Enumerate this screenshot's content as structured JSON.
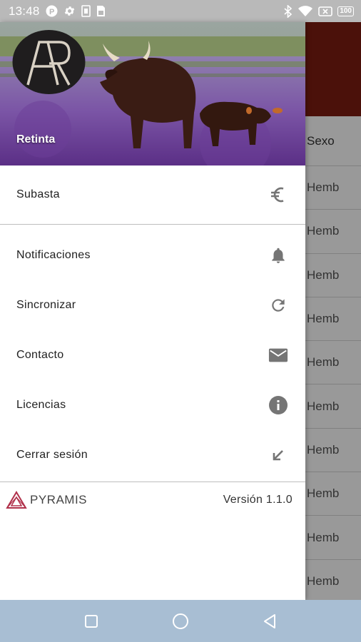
{
  "status_bar": {
    "time": "13:48",
    "left_icons": [
      "p-icon",
      "gear-icon",
      "sd-card-icon",
      "sim-icon"
    ],
    "right_icons": [
      "bluetooth-icon",
      "wifi-icon",
      "close-box-icon"
    ],
    "battery": "100"
  },
  "drawer": {
    "header_title": "Retinta",
    "items": [
      {
        "label": "Subasta",
        "icon": "euro-icon"
      },
      {
        "label": "Notificaciones",
        "icon": "bell-icon"
      },
      {
        "label": "Sincronizar",
        "icon": "refresh-icon"
      },
      {
        "label": "Contacto",
        "icon": "mail-icon"
      },
      {
        "label": "Licencias",
        "icon": "info-icon"
      },
      {
        "label": "Cerrar sesión",
        "icon": "arrow-down-left-icon"
      }
    ],
    "footer": {
      "brand": "PYRAMIS",
      "version": "Versión 1.1.0"
    }
  },
  "background_list": {
    "header": "Sexo",
    "rows": [
      "Hemb",
      "Hemb",
      "Hemb",
      "Hemb",
      "Hemb",
      "Hemb",
      "Hemb",
      "Hemb",
      "Hemb",
      "Hemb"
    ]
  },
  "nav_bar": {
    "buttons": [
      "square-icon",
      "circle-icon",
      "back-triangle-icon"
    ]
  },
  "colors": {
    "status_bar": "#b9b9b9",
    "header_accent": "#7d1d12",
    "nav_bar": "#a8bed3"
  }
}
